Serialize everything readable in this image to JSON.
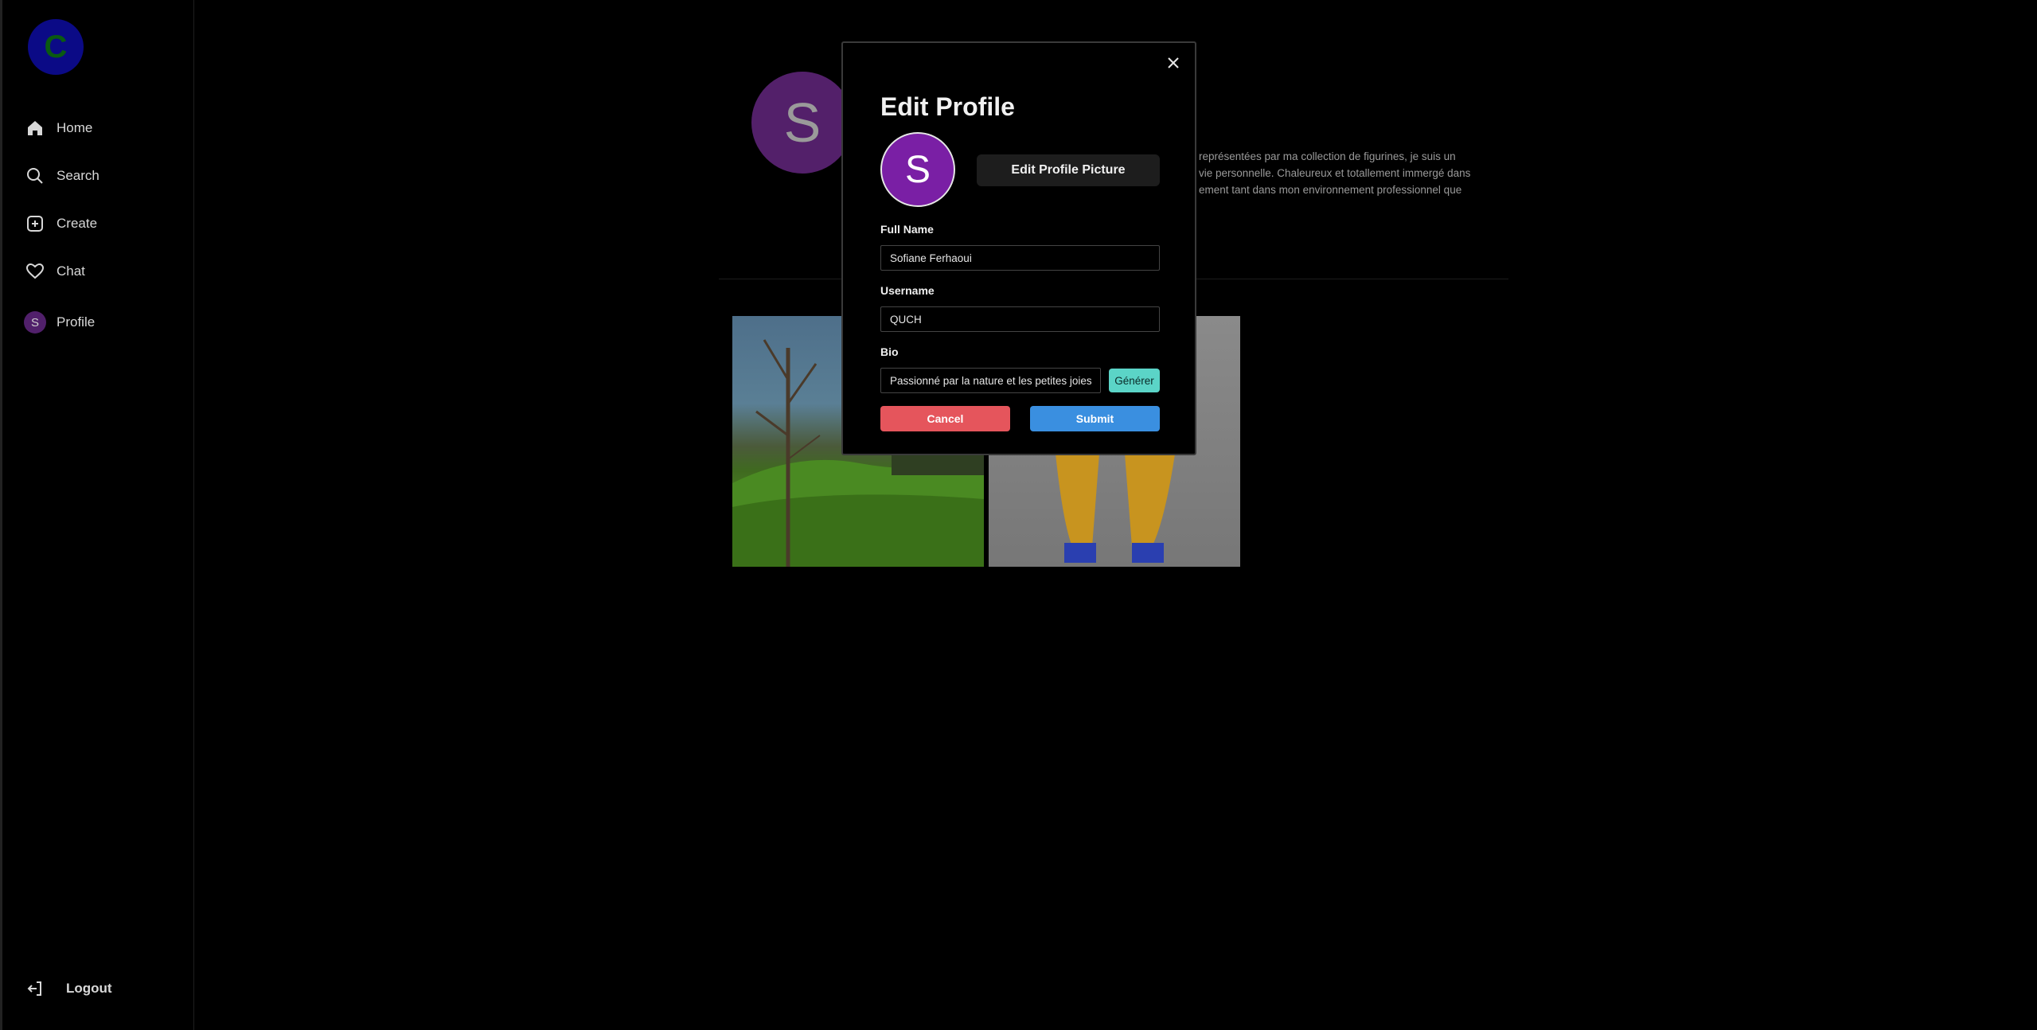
{
  "sidebar": {
    "brand_letter": "C",
    "items": [
      {
        "label": "Home",
        "icon": "home-icon"
      },
      {
        "label": "Search",
        "icon": "search-icon"
      },
      {
        "label": "Create",
        "icon": "plus-square-icon"
      },
      {
        "label": "Chat",
        "icon": "heart-icon"
      },
      {
        "label": "Profile",
        "icon": "avatar",
        "avatar_letter": "S"
      }
    ],
    "logout_label": "Logout"
  },
  "profile": {
    "avatar_letter": "S",
    "bio_lines": [
      "représentées par ma collection de figurines, je suis un",
      "vie personnelle. Chaleureux et totallement immergé dans",
      "ement tant dans mon environnement professionnel que"
    ],
    "posts": [
      "landscape-photo",
      "figurine-photo"
    ]
  },
  "modal": {
    "title": "Edit Profile",
    "avatar_letter": "S",
    "edit_picture_label": "Edit Profile Picture",
    "full_name_label": "Full Name",
    "full_name_value": "Sofiane Ferhaoui",
    "username_label": "Username",
    "username_value": "QUCH",
    "bio_label": "Bio",
    "bio_value": "Passionné par la nature et les petites joies",
    "generate_label": "Générer",
    "cancel_label": "Cancel",
    "submit_label": "Submit"
  },
  "colors": {
    "cancel": "#e5555c",
    "submit": "#3a8fe0",
    "generate": "#5bd4c7",
    "avatar": "#7a1fa5"
  }
}
